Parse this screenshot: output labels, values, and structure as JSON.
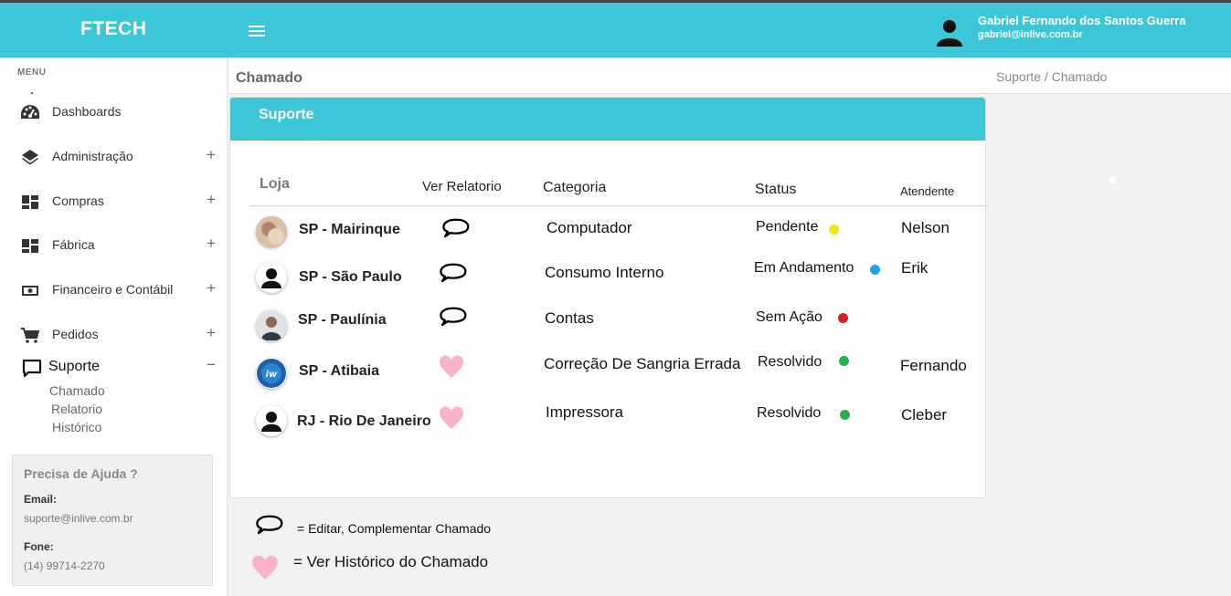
{
  "header": {
    "brand": "FTECH",
    "user_name": "Gabriel Fernando dos Santos Guerra",
    "user_email": "gabriel@inlive.com.br"
  },
  "sidebar": {
    "menu_label": "MENU",
    "items": [
      {
        "label": "Dashboards",
        "icon": "dashboard-icon",
        "toggle": ""
      },
      {
        "label": "Administração",
        "icon": "layers-icon",
        "toggle": "+"
      },
      {
        "label": "Compras",
        "icon": "dashboard-grid-icon",
        "toggle": "+"
      },
      {
        "label": "Fábrica",
        "icon": "dashboard-grid-icon",
        "toggle": "+"
      },
      {
        "label": "Financeiro e Contábil",
        "icon": "money-icon",
        "toggle": "+"
      },
      {
        "label": "Pedidos",
        "icon": "cart-icon",
        "toggle": "+"
      },
      {
        "label": "Suporte",
        "icon": "chat-icon",
        "toggle": "−"
      }
    ],
    "sub_items": [
      "Chamado",
      "Relatorio",
      "Histórico"
    ],
    "help": {
      "title": "Precisa de Ajuda ?",
      "email_label": "Email:",
      "email": "suporte@inlive.com.br",
      "phone_label": "Fone:",
      "phone": "(14) 99714-2270"
    }
  },
  "page": {
    "title": "Chamado",
    "breadcrumb": "Suporte / Chamado"
  },
  "card": {
    "title": "Suporte",
    "columns": [
      "Loja",
      "Ver Relatorio",
      "Categoria",
      "Status",
      "Atendente"
    ],
    "rows": [
      {
        "store": "SP - Mairinque",
        "avatar": "photo-avatar",
        "action": "speech-bubble-icon",
        "category": "Computador",
        "status": "Pendente",
        "status_color": "#f5e50a",
        "attendant": "Nelson"
      },
      {
        "store": "SP - São Paulo",
        "avatar": "person-avatar",
        "action": "speech-bubble-icon",
        "category": "Consumo Interno",
        "status": "Em Andamento",
        "status_color": "#1ca3e8",
        "attendant": "Erik"
      },
      {
        "store": "SP - Paulínia",
        "avatar": "photo-avatar",
        "action": "speech-bubble-icon",
        "category": "Contas",
        "status": "Sem Ação",
        "status_color": "#e01b24",
        "attendant": ""
      },
      {
        "store": "SP - Atibaia",
        "avatar": "logo-avatar",
        "action": "heart-icon",
        "category": "Correção De Sangria Errada",
        "status": "Resolvido",
        "status_color": "#21b24a",
        "attendant": "Fernando"
      },
      {
        "store": "RJ - Rio De Janeiro",
        "avatar": "person-avatar",
        "action": "heart-icon",
        "category": "Impressora",
        "status": "Resolvido",
        "status_color": "#21b24a",
        "attendant": "Cleber"
      }
    ]
  },
  "legend": {
    "bubble_text": "=  Editar, Complementar Chamado",
    "heart_text": "= Ver Histórico do Chamado"
  }
}
